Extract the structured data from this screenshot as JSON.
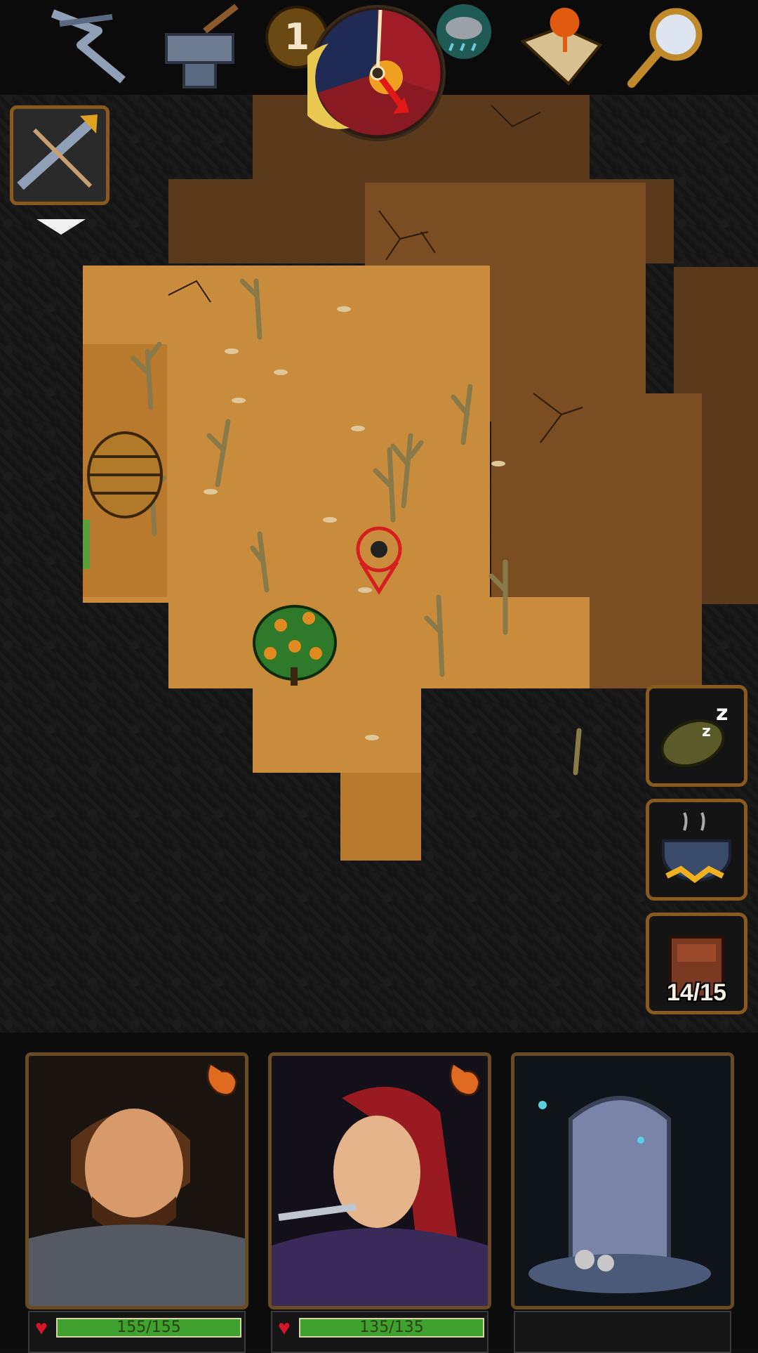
{
  "top_bar": {
    "icons": [
      "crossbow-icon",
      "anvil-icon",
      "day-counter-badge",
      "day-night-clock-icon",
      "rain-cloud-icon",
      "treasure-map-icon",
      "magnifier-icon"
    ],
    "day_number": "1"
  },
  "quick_slot": {
    "item_icon": "crossbow-icon"
  },
  "side_actions": {
    "sleep_icon": "sleeping-bag-icon",
    "cook_icon": "cooking-pot-icon",
    "backpack_icon": "backpack-icon",
    "backpack_count": "14/15"
  },
  "party": [
    {
      "portrait": "warrior-portrait",
      "hp_text": "155/155",
      "hp_fill": 1.0
    },
    {
      "portrait": "rogue-portrait",
      "hp_text": "135/135",
      "hp_fill": 1.0
    },
    {
      "portrait": "tombstone-portrait"
    }
  ],
  "colors": {
    "frame_brown": "#8a5a1c",
    "hp_green": "#3fa22e",
    "heart_red": "#d6142a",
    "sand": "#c98c3d",
    "dirt": "#5a3a1a"
  }
}
